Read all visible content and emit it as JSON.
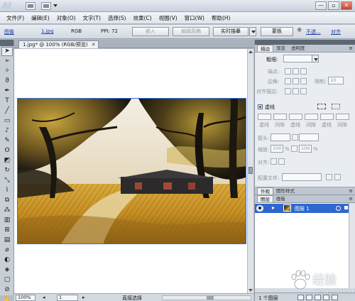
{
  "app": {
    "logo": "Ai"
  },
  "window_controls": {
    "minimize": "—",
    "restore": "▫",
    "close": "✕"
  },
  "menu": [
    "文件(F)",
    "编辑(E)",
    "对象(O)",
    "文字(T)",
    "选择(S)",
    "效果(C)",
    "视图(V)",
    "窗口(W)",
    "帮助(H)"
  ],
  "control_bar": {
    "object_type": "图像",
    "file_link": "1.jpg",
    "color_mode": "RGB",
    "ppi": "PPI: 72",
    "embed_label": "嵌入",
    "edit_original_label": "编辑原稿",
    "live_trace_label": "实时描摹",
    "mask_label": "蒙板",
    "opacity_link": "不透...",
    "align_link": "对齐"
  },
  "document": {
    "tab_title": "1.jpg* @ 100% (RGB/预览)",
    "close_glyph": "✕"
  },
  "tools": [
    "selection",
    "direct-selection",
    "magic-wand",
    "lasso",
    "pen",
    "type",
    "line-segment",
    "rectangle",
    "paintbrush",
    "pencil",
    "blob-brush",
    "eraser",
    "rotate",
    "scale",
    "warp",
    "free-transform",
    "symbol-sprayer",
    "column-graph",
    "mesh",
    "gradient",
    "eyedropper",
    "blend",
    "live-paint",
    "artboard",
    "slice",
    "hand",
    "zoom"
  ],
  "status_bar": {
    "zoom": "100%",
    "artboard": "1",
    "tool_name": "直接选择"
  },
  "stroke_panel": {
    "tabs": [
      "描边",
      "渐变",
      "透明度"
    ],
    "weight_label": "粗细:",
    "cap_label": "端点:",
    "corner_label": "边角:",
    "limit_label": "限制:",
    "limit_value": "10",
    "align_label": "对齐描边:",
    "dashed_label": "虚线",
    "dashed_checked": true,
    "dash_cells": [
      "虚线",
      "间隙",
      "虚线",
      "间隙",
      "虚线",
      "间隙"
    ],
    "arrow_label": "箭头:",
    "scale_label": "缩放:",
    "scale_values": [
      "100",
      "100"
    ],
    "scale_unit": "%",
    "align_arrow_label": "对齐:",
    "profile_label": "配置文件:"
  },
  "layers_panel": {
    "tabs": [
      "外观",
      "图形样式"
    ],
    "sub_tabs": [
      "图层",
      "画板"
    ],
    "layer_name": "图层 1",
    "count_label": "1 个图层"
  },
  "watermark": {
    "text": "经验",
    "url": "jingyan.baidu.com"
  }
}
